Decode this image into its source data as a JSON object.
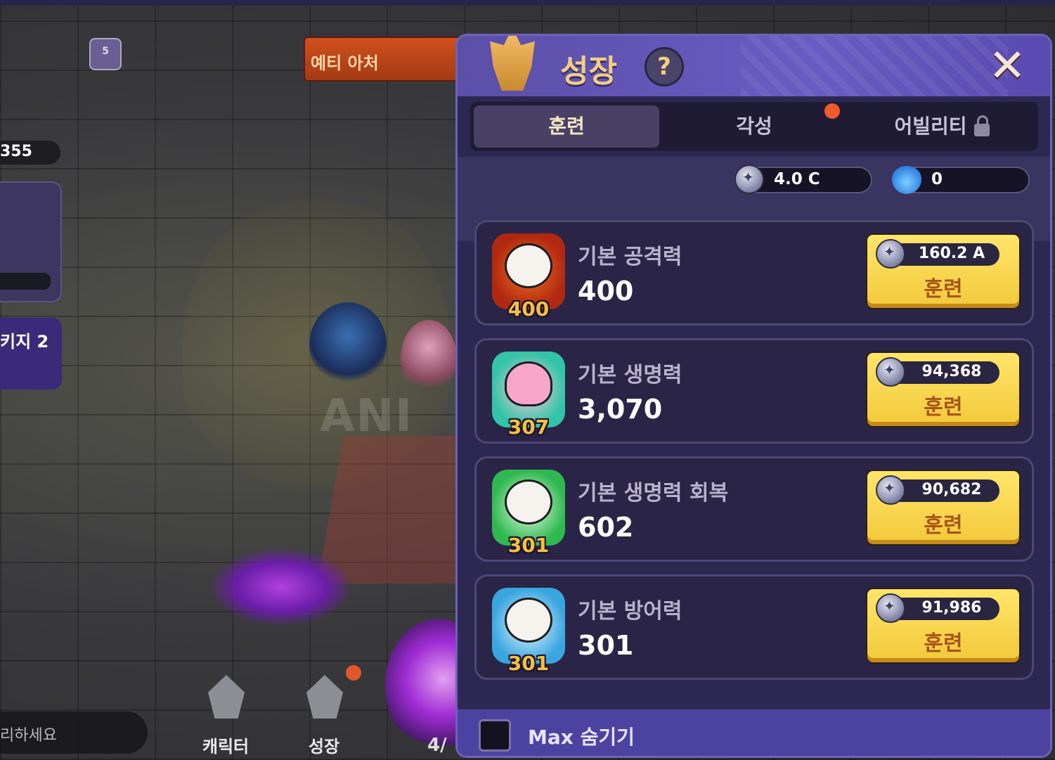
{
  "scene": {
    "stage_badge": "5",
    "boss_name": "예티 아처",
    "left_counter": "355",
    "left_quest": "키지 2",
    "watermark": "ANI",
    "chat_placeholder": "리하세요",
    "nav": [
      {
        "label": "캐릭터",
        "icon": "character-icon"
      },
      {
        "label": "성장",
        "icon": "growth-icon"
      }
    ],
    "wave_counter": "4/"
  },
  "panel": {
    "title": "성장",
    "help_label": "?",
    "close_label": "✕",
    "tabs": [
      {
        "label": "훈련",
        "active": true
      },
      {
        "label": "각성",
        "active": false,
        "notification": true
      },
      {
        "label": "어빌리티",
        "active": false,
        "locked": true
      }
    ],
    "currencies": [
      {
        "icon": "silver-coin-icon",
        "value": "4.0 C"
      },
      {
        "icon": "blue-flame-icon",
        "value": "0"
      }
    ],
    "stats": [
      {
        "name": "기본 공격력",
        "value": "400",
        "level": "400",
        "cost": "160.2 A",
        "button": "훈련",
        "icon": "attack-portrait"
      },
      {
        "name": "기본 생명력",
        "value": "3,070",
        "level": "307",
        "cost": "94,368",
        "button": "훈련",
        "icon": "heart-portrait"
      },
      {
        "name": "기본 생명력 회복",
        "value": "602",
        "level": "301",
        "cost": "90,682",
        "button": "훈련",
        "icon": "regen-portrait"
      },
      {
        "name": "기본 방어력",
        "value": "301",
        "level": "301",
        "cost": "91,986",
        "button": "훈련",
        "icon": "defense-portrait"
      }
    ],
    "hide_max_label": "Max 숨기기",
    "hide_max_checked": false
  },
  "colors": {
    "panel_bg": "#2c2750",
    "header": "#6a5bc2",
    "title": "#f2cf82",
    "train_button": "#f3c93a",
    "level_text": "#f3c040",
    "notification_dot": "#f15a2a"
  }
}
